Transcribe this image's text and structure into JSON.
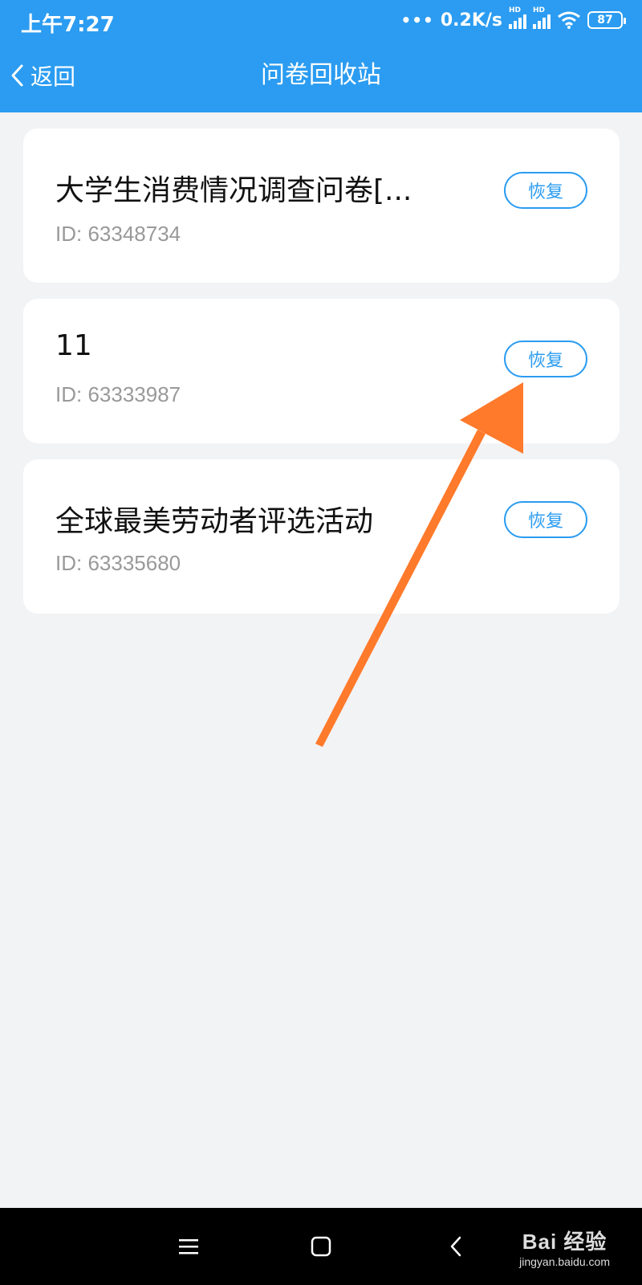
{
  "status_bar": {
    "time": "上午7:27",
    "network_speed": "0.2K/s",
    "signal_label_1": "HD",
    "signal_label_2": "HD",
    "battery": "87"
  },
  "nav": {
    "back_label": "返回",
    "title": "问卷回收站"
  },
  "colors": {
    "primary": "#2b9cf1",
    "background": "#f2f3f5",
    "arrow": "#ff7a2b"
  },
  "surveys": [
    {
      "title": "大学生消费情况调查问卷[...",
      "id_text": "ID: 63348734",
      "restore_label": "恢复"
    },
    {
      "title": "11",
      "id_text": "ID: 63333987",
      "restore_label": "恢复"
    },
    {
      "title": "全球最美劳动者评选活动",
      "id_text": "ID: 63335680",
      "restore_label": "恢复"
    }
  ],
  "system_nav": {
    "menu_icon": "menu-icon",
    "home_icon": "home-icon",
    "back_icon": "back-icon"
  },
  "watermark": {
    "logo": "Bai 经验",
    "url": "jingyan.baidu.com"
  }
}
